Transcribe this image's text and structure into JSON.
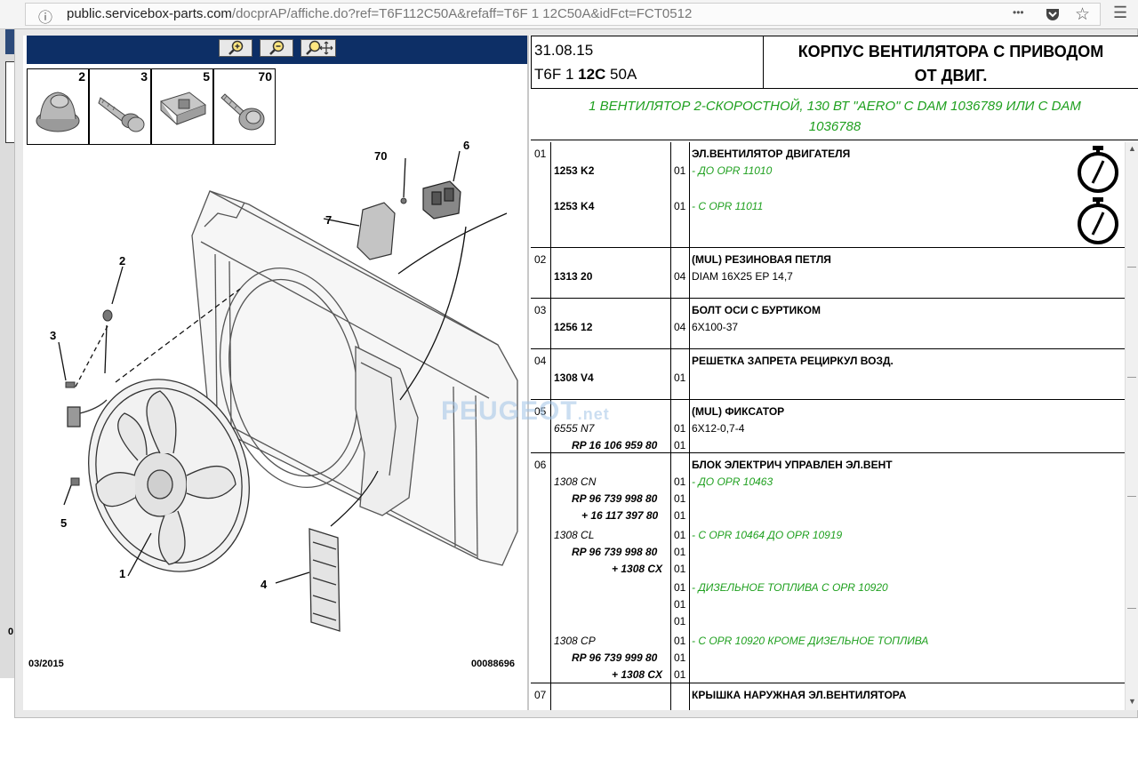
{
  "browser": {
    "url_domain": "public.servicebox-parts.com",
    "url_path": "/docprAP/affiche.do?ref=T6F112C50A&refaff=T6F 1 12C50A&idFct=FCT0512",
    "icons": [
      "info-icon",
      "more-icon",
      "pocket-icon",
      "bookmark-star-icon",
      "menu-icon"
    ],
    "more_glyph": "•••",
    "star_glyph": "☆",
    "menu_glyph": "☰",
    "info_glyph": "ⓘ"
  },
  "toolbar": {
    "zoom_in_label": "+",
    "zoom_out_label": "−",
    "zoom_pan_label": "✥"
  },
  "thumbnails": [
    "2",
    "3",
    "5",
    "70"
  ],
  "diagram": {
    "callouts": [
      "70",
      "6",
      "7",
      "2",
      "3",
      "5",
      "1",
      "4"
    ],
    "date_code": "03/2015",
    "ref_code": "00088696",
    "side_mark": "0"
  },
  "header": {
    "date": "31.08.15",
    "code_a": "T6F 1 ",
    "code_b": "12C",
    "code_c": " 50A",
    "title_line1": "КОРПУС ВЕНТИЛЯТОРА С ПРИВОДОМ",
    "title_line2": "ОТ ДВИГ."
  },
  "subheader": {
    "line1": "1 ВЕНТИЛЯТОР 2-СКОРОСТНОЙ, 130 ВТ \"AERO\" С DAM 1036789 ИЛИ С DAM",
    "line2": "1036788"
  },
  "watermark": {
    "main": "PEUGEOT",
    "suffix": ".net"
  },
  "rows": {
    "r01": {
      "no": "01",
      "ref1": "1253 K2",
      "q1": "01",
      "desc": "ЭЛ.ВЕНТИЛЯТОР ДВИГАТЕЛЯ",
      "cond1": "- ДО OPR 11010",
      "ref2": "1253 K4",
      "q2": "01",
      "cond2": "- С OPR 11011"
    },
    "r02": {
      "no": "02",
      "ref": "1313 20",
      "q": "04",
      "desc": "(MUL) РЕЗИНОВАЯ ПЕТЛЯ",
      "spec": "DIAM 16X25 EP 14,7"
    },
    "r03": {
      "no": "03",
      "ref": "1256 12",
      "q": "04",
      "desc": "БОЛТ ОСИ С БУРТИКОМ",
      "spec": "6X100-37"
    },
    "r04": {
      "no": "04",
      "ref": "1308 V4",
      "q": "01",
      "desc": "РЕШЕТКА ЗАПРЕТА РЕЦИРКУЛ ВОЗД."
    },
    "r05": {
      "no": "05",
      "ref1": "6555 N7",
      "ref2": "RP 16 106 959 80",
      "q1": "01",
      "q2": "01",
      "desc": "(MUL) ФИКСАТОР",
      "spec": "6X12-0,7-4"
    },
    "r06": {
      "no": "06",
      "desc": "БЛОК ЭЛЕКТРИЧ УПРАВЛЕН ЭЛ.ВЕНТ",
      "a_ref1": "1308 CN",
      "a_ref2": "RP 96 739 998 80",
      "a_ref3": "+ 16 117 397 80",
      "a_q1": "01",
      "a_q2": "01",
      "a_q3": "01",
      "a_cond": "- ДО OPR 10463",
      "b_ref1": "1308 CL",
      "b_ref2": "RP 96 739 998 80",
      "b_ref3": "+ 1308 CX",
      "b_q1": "01",
      "b_q2": "01",
      "b_q3": "01",
      "b_cond": "- С OPR 10464 ДО OPR 10919",
      "c_q1": "01",
      "c_q2": "01",
      "c_q3": "01",
      "c_cond": "- ДИЗЕЛЬНОЕ ТОПЛИВА С OPR 10920",
      "d_ref1": "1308 CP",
      "d_ref2": "RP 96 739 999 80",
      "d_ref3": "+ 1308 CX",
      "d_q1": "01",
      "d_q2": "01",
      "d_q3": "01",
      "d_cond": "- С OPR 10920 КРОМЕ ДИЗЕЛЬНОЕ ТОПЛИВА"
    },
    "r07": {
      "no": "07",
      "desc": "КРЫШКА НАРУЖНАЯ ЭЛ.ВЕНТИЛЯТОРА"
    }
  }
}
